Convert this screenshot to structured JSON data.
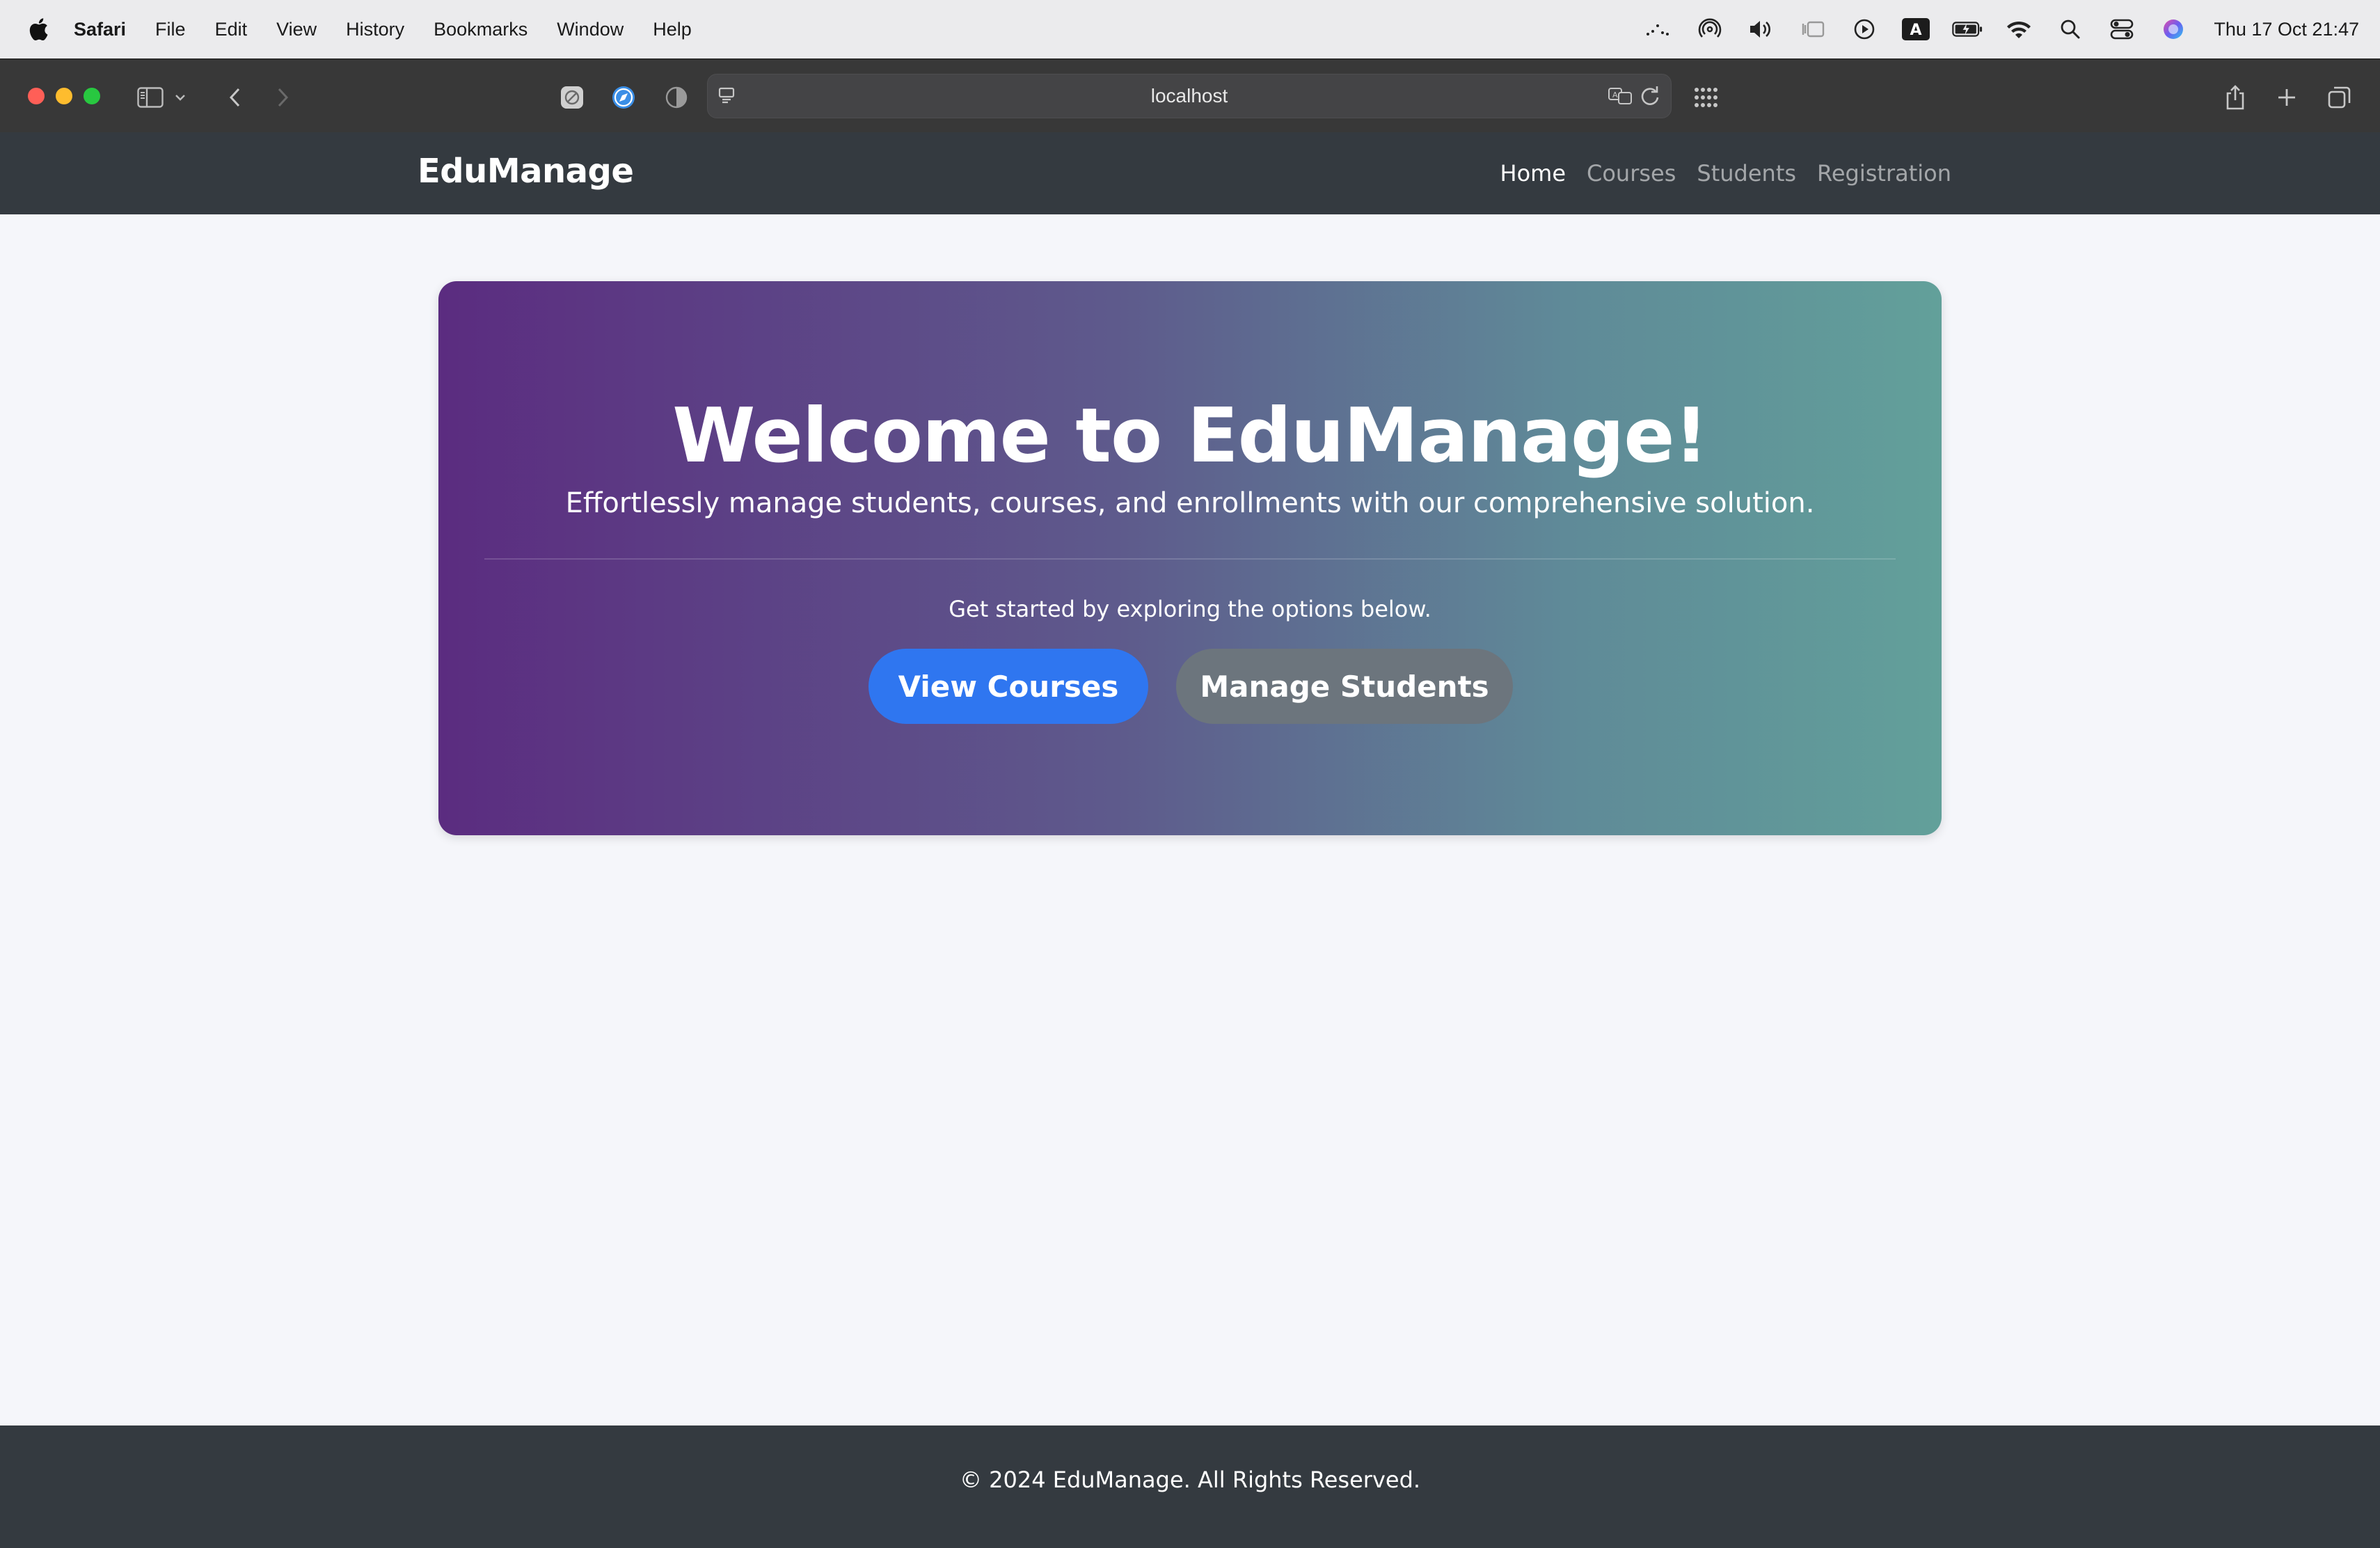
{
  "menubar": {
    "app_name": "Safari",
    "items": [
      "File",
      "Edit",
      "View",
      "History",
      "Bookmarks",
      "Window",
      "Help"
    ],
    "clock": "Thu 17 Oct  21:47",
    "keyboard_indicator": "A"
  },
  "browser": {
    "url": "localhost",
    "traffic_colors": [
      "#ff5f57",
      "#febc2e",
      "#28c840"
    ]
  },
  "site": {
    "brand": "EduManage",
    "nav": [
      {
        "label": "Home",
        "active": true
      },
      {
        "label": "Courses",
        "active": false
      },
      {
        "label": "Students",
        "active": false
      },
      {
        "label": "Registration",
        "active": false
      }
    ]
  },
  "hero": {
    "title": "Welcome to EduManage!",
    "subtitle": "Effortlessly manage students, courses, and enrollments with our comprehensive solution.",
    "lead": "Get started by exploring the options below.",
    "primary_button": "View Courses",
    "secondary_button": "Manage Students",
    "colors": {
      "gradient_start": "#5b2c80",
      "gradient_end": "#62a09a",
      "primary": "#2f76f0",
      "secondary": "#6c757d"
    }
  },
  "footer": {
    "text": "© 2024 EduManage. All Rights Reserved."
  }
}
